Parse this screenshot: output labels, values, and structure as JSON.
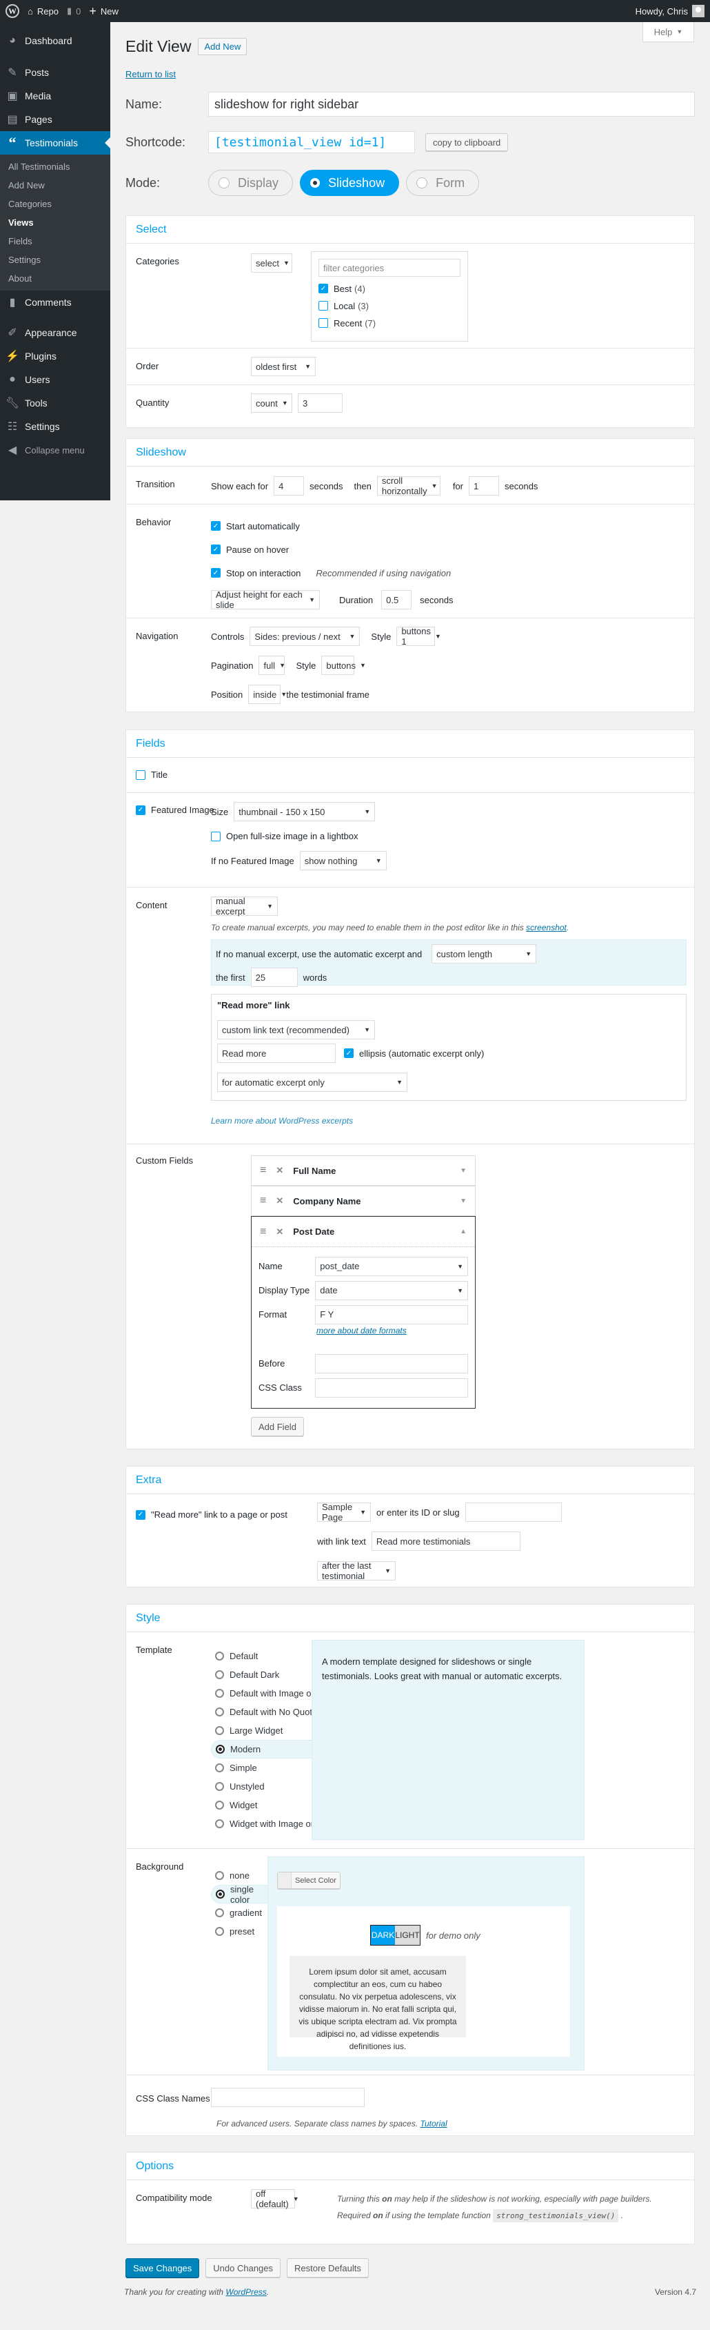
{
  "adminbar": {
    "site": "Repo",
    "comments": "0",
    "new": "New",
    "greeting": "Howdy, Chris"
  },
  "sidebar": {
    "items_top": [
      {
        "icon": "dashboard-icon",
        "label": "Dashboard"
      },
      {
        "icon": "pin-icon",
        "label": "Posts"
      },
      {
        "icon": "media-icon",
        "label": "Media"
      },
      {
        "icon": "pages-icon",
        "label": "Pages"
      },
      {
        "icon": "quote-icon",
        "label": "Testimonials"
      }
    ],
    "submenu": [
      "All Testimonials",
      "Add New",
      "Categories",
      "Views",
      "Fields",
      "Settings",
      "About"
    ],
    "current_sub": "Views",
    "items_bottom": [
      {
        "icon": "comment-icon",
        "label": "Comments"
      },
      {
        "icon": "brush-icon",
        "label": "Appearance"
      },
      {
        "icon": "plug-icon",
        "label": "Plugins"
      },
      {
        "icon": "user-icon",
        "label": "Users"
      },
      {
        "icon": "wrench-icon",
        "label": "Tools"
      },
      {
        "icon": "sliders-icon",
        "label": "Settings"
      }
    ],
    "collapse": "Collapse menu"
  },
  "help": "Help",
  "header": {
    "title": "Edit View",
    "add_new": "Add New",
    "return": "Return to list"
  },
  "top": {
    "name_label": "Name:",
    "name_value": "slideshow for right sidebar",
    "shortcode_label": "Shortcode:",
    "shortcode_value": "[testimonial_view id=1]",
    "copy": "copy to clipboard",
    "mode_label": "Mode:",
    "modes": [
      "Display",
      "Slideshow",
      "Form"
    ],
    "mode_selected": "Slideshow"
  },
  "select": {
    "title": "Select",
    "categories_label": "Categories",
    "categories_mode": "select",
    "filter_placeholder": "filter categories",
    "categories": [
      {
        "label": "Best",
        "count": "(4)",
        "checked": true
      },
      {
        "label": "Local",
        "count": "(3)",
        "checked": false
      },
      {
        "label": "Recent",
        "count": "(7)",
        "checked": false
      }
    ],
    "order_label": "Order",
    "order_value": "oldest first",
    "quantity_label": "Quantity",
    "quantity_mode": "count",
    "quantity_value": "3"
  },
  "slideshow": {
    "title": "Slideshow",
    "transition_label": "Transition",
    "show_each_for": "Show each for",
    "show_value": "4",
    "seconds": "seconds",
    "then": "then",
    "effect": "scroll horizontally",
    "for": "for",
    "effect_duration": "1",
    "behavior_label": "Behavior",
    "start_auto": "Start automatically",
    "pause_hover": "Pause on hover",
    "stop_interaction": "Stop on interaction",
    "recommended": "Recommended if using navigation",
    "height_mode": "Adjust height for each slide",
    "duration_label": "Duration",
    "duration_value": "0.5",
    "navigation_label": "Navigation",
    "controls_label": "Controls",
    "controls_value": "Sides: previous / next",
    "style_label": "Style",
    "controls_style": "buttons 1",
    "pagination_label": "Pagination",
    "pagination_value": "full",
    "pagination_style": "buttons",
    "position_label": "Position",
    "position_value": "inside",
    "position_suffix": "the testimonial frame"
  },
  "fields": {
    "title": "Fields",
    "title_field": "Title",
    "featured_image": "Featured Image",
    "size_label": "Size",
    "size_value": "thumbnail - 150 x 150",
    "lightbox": "Open full-size image in a lightbox",
    "if_no_image": "If no Featured Image",
    "if_no_image_value": "show nothing",
    "content_label": "Content",
    "content_value": "manual excerpt",
    "excerpt_note": "To create manual excerpts, you may need to enable them in the post editor like in this",
    "excerpt_link": "screenshot",
    "auto_excerpt_text": "If no manual excerpt, use the automatic excerpt and",
    "auto_excerpt_value": "custom length",
    "the_first": "the first",
    "words_value": "25",
    "words": "words",
    "read_more_title": "\"Read more\" link",
    "read_more_mode": "custom link text (recommended)",
    "read_more_text": "Read more",
    "ellipsis": "ellipsis (automatic excerpt only)",
    "read_more_when": "for automatic excerpt only",
    "learn_more": "Learn more about WordPress excerpts",
    "custom_fields_label": "Custom Fields",
    "custom_fields": [
      "Full Name",
      "Company Name",
      "Post Date"
    ],
    "cf_name_label": "Name",
    "cf_name_value": "post_date",
    "cf_type_label": "Display Type",
    "cf_type_value": "date",
    "cf_format_label": "Format",
    "cf_format_value": "F Y",
    "cf_format_link": "more about date formats",
    "cf_before_label": "Before",
    "cf_before_value": "",
    "cf_class_label": "CSS Class",
    "cf_class_value": "",
    "add_field": "Add Field"
  },
  "extra": {
    "title": "Extra",
    "read_more_page": "\"Read more\" link to a page or post",
    "page_value": "Sample Page",
    "or_enter": "or enter its ID or slug",
    "slug_value": "",
    "with_link_text": "with link text",
    "link_text_value": "Read more testimonials",
    "placement": "after the last testimonial"
  },
  "style": {
    "title": "Style",
    "template_label": "Template",
    "templates": [
      "Default",
      "Default Dark",
      "Default with Image on Right",
      "Default with No Quotes",
      "Large Widget",
      "Modern",
      "Simple",
      "Unstyled",
      "Widget",
      "Widget with Image on Right"
    ],
    "template_selected": "Modern",
    "template_desc": "A modern template designed for slideshows or single testimonials. Looks great with manual or automatic excerpts.",
    "background_label": "Background",
    "backgrounds": [
      "none",
      "single color",
      "gradient",
      "preset"
    ],
    "background_selected": "single color",
    "select_color": "Select Color",
    "dark": "DARK",
    "light": "LIGHT",
    "demo_only": "for demo only",
    "lorem": "Lorem ipsum dolor sit amet, accusam complectitur an eos, cum cu habeo consulatu. No vix perpetua adolescens, vix vidisse maiorum in. No erat falli scripta qui, vis ubique scripta electram ad. Vix prompta adipisci no, ad vidisse expetendis definitiones ius.",
    "css_label": "CSS Class Names",
    "css_value": "",
    "css_note": "For advanced users. Separate class names by spaces.",
    "css_link": "Tutorial"
  },
  "options": {
    "title": "Options",
    "compat_label": "Compatibility mode",
    "compat_value": "off (default)",
    "note1_a": "Turning this ",
    "note1_b": "on",
    "note1_c": " may help if the slideshow is not working, especially with page builders.",
    "note2_a": "Required ",
    "note2_b": "on",
    "note2_c": " if using the template function",
    "note2_code": "strong_testimonials_view()"
  },
  "actions": {
    "save": "Save Changes",
    "undo": "Undo Changes",
    "restore": "Restore Defaults"
  },
  "footer": {
    "thanks": "Thank you for creating with",
    "wp": "WordPress",
    "version": "Version 4.7"
  },
  "colors": {
    "accent": "#00a0f0",
    "wp_blue": "#0073aa",
    "primary_button": "#0085ba",
    "sidebar": "#23282d"
  }
}
